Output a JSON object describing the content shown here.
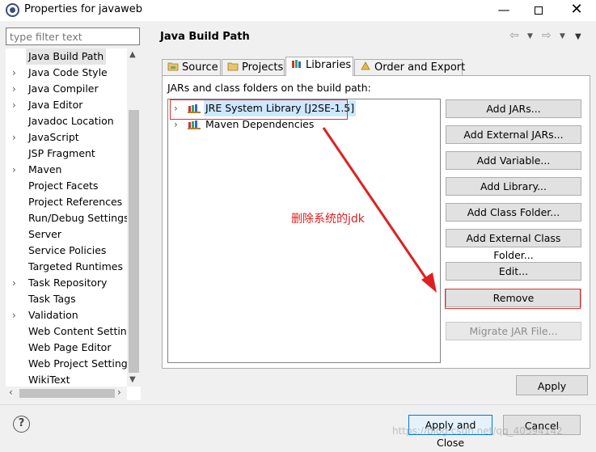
{
  "window": {
    "title": "Properties for javaweb",
    "minimize_glyph": "—",
    "close_glyph": "✕"
  },
  "filter": {
    "placeholder": "type filter text"
  },
  "tree": {
    "items": [
      {
        "label": "Java Build Path",
        "expandable": false,
        "selected": true
      },
      {
        "label": "Java Code Style",
        "expandable": true
      },
      {
        "label": "Java Compiler",
        "expandable": true
      },
      {
        "label": "Java Editor",
        "expandable": true
      },
      {
        "label": "Javadoc Location",
        "expandable": false
      },
      {
        "label": "JavaScript",
        "expandable": true
      },
      {
        "label": "JSP Fragment",
        "expandable": false
      },
      {
        "label": "Maven",
        "expandable": true
      },
      {
        "label": "Project Facets",
        "expandable": false
      },
      {
        "label": "Project References",
        "expandable": false
      },
      {
        "label": "Run/Debug Settings",
        "expandable": false
      },
      {
        "label": "Server",
        "expandable": false
      },
      {
        "label": "Service Policies",
        "expandable": false
      },
      {
        "label": "Targeted Runtimes",
        "expandable": false
      },
      {
        "label": "Task Repository",
        "expandable": true
      },
      {
        "label": "Task Tags",
        "expandable": false
      },
      {
        "label": "Validation",
        "expandable": true
      },
      {
        "label": "Web Content Settings",
        "expandable": false
      },
      {
        "label": "Web Page Editor",
        "expandable": false
      },
      {
        "label": "Web Project Settings",
        "expandable": false
      },
      {
        "label": "WikiText",
        "expandable": false
      }
    ]
  },
  "page": {
    "title": "Java Build Path"
  },
  "tabs": [
    {
      "label": "Source",
      "icon": "source-folder-icon"
    },
    {
      "label": "Projects",
      "icon": "projects-folder-icon"
    },
    {
      "label": "Libraries",
      "icon": "libraries-icon",
      "active": true
    },
    {
      "label": "Order and Export",
      "icon": "order-export-icon"
    }
  ],
  "libraries": {
    "label": "JARs and class folders on the build path:",
    "entries": [
      {
        "label": "JRE System Library [J2SE-1.5]",
        "selected": true
      },
      {
        "label": "Maven Dependencies"
      }
    ],
    "buttons": [
      {
        "label": "Add JARs...",
        "enabled": true
      },
      {
        "label": "Add External JARs...",
        "enabled": true
      },
      {
        "label": "Add Variable...",
        "enabled": true
      },
      {
        "label": "Add Library...",
        "enabled": true
      },
      {
        "label": "Add Class Folder...",
        "enabled": true
      },
      {
        "label": "Add External Class Folder...",
        "enabled": true
      },
      {
        "label": "Edit...",
        "enabled": true
      },
      {
        "label": "Remove",
        "enabled": true,
        "highlighted": true
      },
      {
        "label": "Migrate JAR File...",
        "enabled": false
      }
    ]
  },
  "annotation": {
    "text": "删除系统的jdk",
    "color": "#e02020"
  },
  "footer": {
    "apply": "Apply",
    "apply_and_close": "Apply and Close",
    "cancel": "Cancel",
    "watermark": "https://blog.csdn.net/qq_40594142"
  },
  "colors": {
    "selection": "#cce8ff",
    "highlight_red": "#e03030",
    "default_button_border": "#0078d7"
  }
}
